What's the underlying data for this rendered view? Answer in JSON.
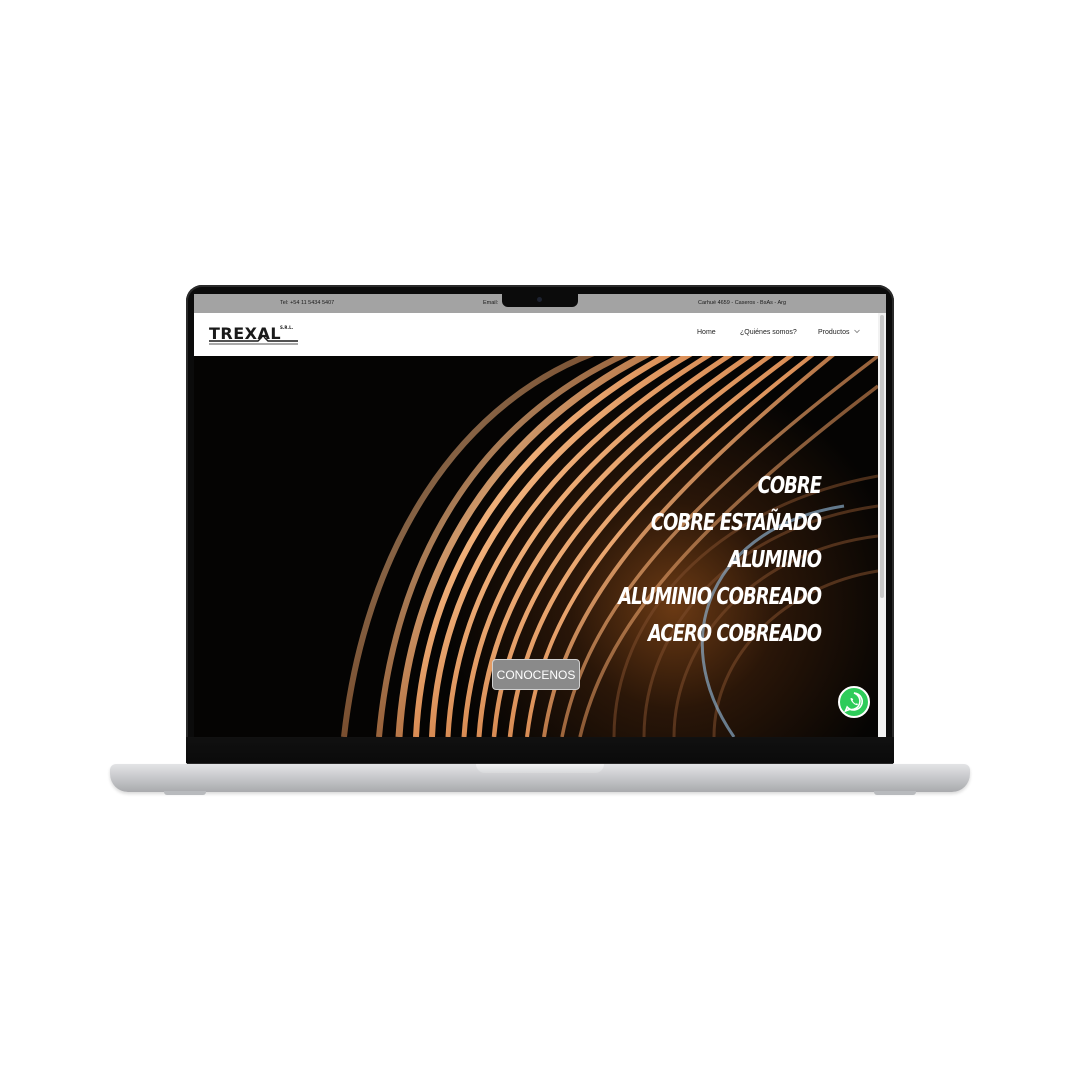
{
  "topbar": {
    "phone": "Tel: +54 11 5434 5407",
    "email": "Email:",
    "address": "Carhué 4659 - Caseros - BsAs - Arg"
  },
  "navbar": {
    "logo_text": "TREXAL",
    "logo_suffix": "S.R.L.",
    "items": [
      {
        "label": "Home"
      },
      {
        "label": "¿Quiénes somos?"
      },
      {
        "label": "Productos"
      }
    ],
    "dropdown_icon": "chevron-down-icon"
  },
  "hero": {
    "headline_lines": [
      "COBRE",
      "COBRE ESTAÑADO",
      "ALUMINIO",
      "ALUMINIO COBREADO",
      "ACERO COBREADO"
    ],
    "cta_label": "CONOCENOS",
    "whatsapp_icon": "whatsapp-icon"
  },
  "colors": {
    "topbar": "#a3a3a3",
    "cta_background": "#8a8a8a",
    "whatsapp": "#2ecc5a",
    "copper": "#c8733a"
  }
}
